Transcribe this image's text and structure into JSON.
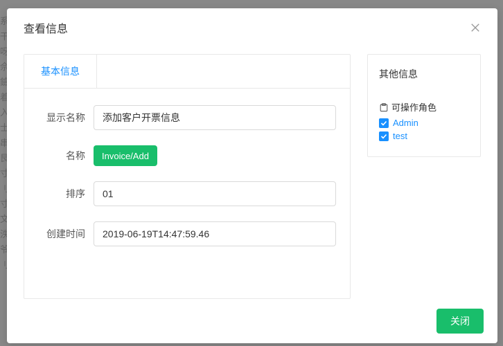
{
  "modal": {
    "title": "查看信息",
    "close_button_label": "关闭"
  },
  "tabs": {
    "basic_info_label": "基本信息"
  },
  "form": {
    "display_name": {
      "label": "显示名称",
      "value": "添加客户开票信息"
    },
    "name": {
      "label": "名称",
      "value": "Invoice/Add"
    },
    "sort": {
      "label": "排序",
      "value": "01"
    },
    "created_at": {
      "label": "创建时间",
      "value": "2019-06-19T14:47:59.46"
    }
  },
  "right": {
    "title": "其他信息",
    "roles_header": "可操作角色",
    "roles": [
      {
        "label": "Admin",
        "checked": true
      },
      {
        "label": "test",
        "checked": true
      }
    ]
  }
}
